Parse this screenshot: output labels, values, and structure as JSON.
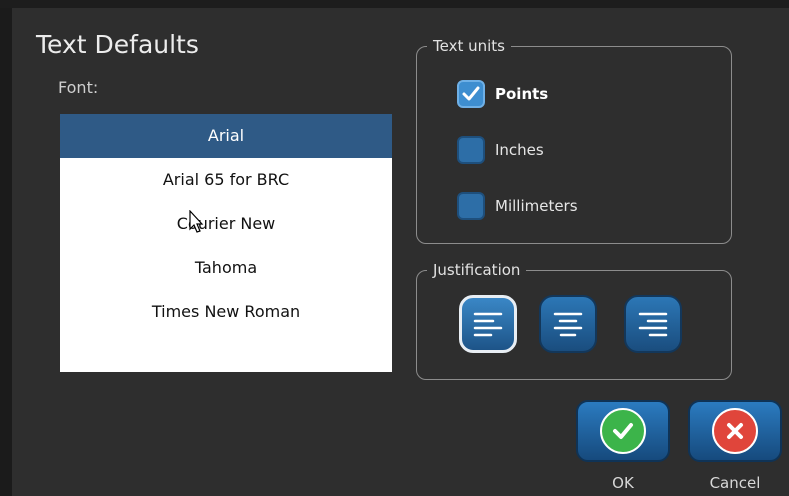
{
  "dialog": {
    "title": "Text Defaults"
  },
  "font": {
    "label": "Font:",
    "items": [
      "Arial",
      "Arial 65 for BRC",
      "Courier New",
      "Tahoma",
      "Times New Roman"
    ],
    "selected": "Arial"
  },
  "text_units": {
    "legend": "Text units",
    "options": [
      {
        "label": "Points",
        "checked": true
      },
      {
        "label": "Inches",
        "checked": false
      },
      {
        "label": "Millimeters",
        "checked": false
      }
    ]
  },
  "justification": {
    "legend": "Justification",
    "options": [
      "left-align-icon",
      "center-align-icon",
      "right-align-icon"
    ],
    "selected": "left"
  },
  "buttons": {
    "ok": "OK",
    "cancel": "Cancel"
  },
  "colors": {
    "accent": "#2f5a86",
    "ok_green": "#3cb44a",
    "cancel_red": "#e0453b",
    "button_blue": "#2b7bc0"
  }
}
